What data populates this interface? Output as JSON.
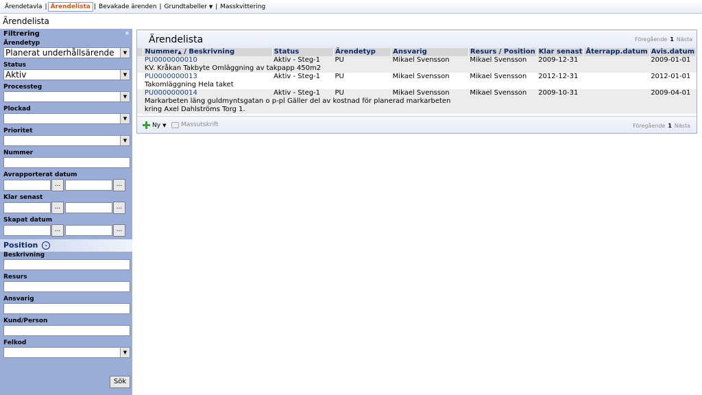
{
  "nav": {
    "items": [
      "Ärendetavla",
      "Ärendelista",
      "Bevakade ärenden",
      "Grundtabeller",
      "Masskvittering"
    ],
    "active": "Ärendelista"
  },
  "page_title": "Ärendelista",
  "sidebar": {
    "title": "Filtrering",
    "arendetyp_label": "Ärendetyp",
    "arendetyp_value": "Planerat underhållsärende",
    "status_label": "Status",
    "status_value": "Aktiv",
    "processteg_label": "Processteg",
    "plockad_label": "Plockad",
    "prioritet_label": "Prioritet",
    "nummer_label": "Nummer",
    "avrapporterat_label": "Avrapporterat datum",
    "klar_senast_label": "Klar senast",
    "skapat_label": "Skapat datum",
    "date_button": "...",
    "position_header": "Position",
    "beskrivning_label": "Beskrivning",
    "resurs_label": "Resurs",
    "ansvarig_label": "Ansvarig",
    "kund_label": "Kund/Person",
    "felkod_label": "Felkod",
    "search_button": "Sök"
  },
  "panel": {
    "title": "Ärendelista",
    "pager": {
      "prev": "Föregående",
      "page": "1",
      "next": "Nästa"
    },
    "columns": {
      "nummer": "Nummer",
      "beskrivning": "Beskrivning",
      "status": "Status",
      "arendetyp": "Ärendetyp",
      "ansvarig": "Ansvarig",
      "resurs": "Resurs",
      "position": "Position",
      "klar_senast": "Klar senast",
      "aterrapp": "Återrapp.datum",
      "avis": "Avis.datum"
    },
    "rows": [
      {
        "nummer": "PU0000000010",
        "status": "Aktiv - Steg-1",
        "typ": "PU",
        "ansvarig": "Mikael Svensson",
        "resurs": "Mikael Svensson",
        "klar": "2009-12-31",
        "aterrapp": "",
        "avis": "2009-01-01",
        "desc1": "KV. Kråkan Takbyte Omläggning av takpapp 450m2",
        "desc2": ""
      },
      {
        "nummer": "PU0000000013",
        "status": "Aktiv - Steg-1",
        "typ": "PU",
        "ansvarig": "Mikael Svensson",
        "resurs": "Mikael Svensson",
        "klar": "2012-12-31",
        "aterrapp": "",
        "avis": "2012-01-01",
        "desc1": "Takomläggning Hela taket",
        "desc2": ""
      },
      {
        "nummer": "PU0000000014",
        "status": "Aktiv - Steg-1",
        "typ": "PU",
        "ansvarig": "Mikael Svensson",
        "resurs": "Mikael Svensson",
        "klar": "2009-10-31",
        "aterrapp": "",
        "avis": "2009-04-01",
        "desc1": "Markarbeten läng guldmyntsgatan o p-pl Gäller del av kostnad för planerad markarbeten",
        "desc2": "kring Axel Dahlströms Torg 1."
      }
    ],
    "footer": {
      "new_label": "Ny",
      "mass_print_label": "Massutskrift"
    }
  }
}
